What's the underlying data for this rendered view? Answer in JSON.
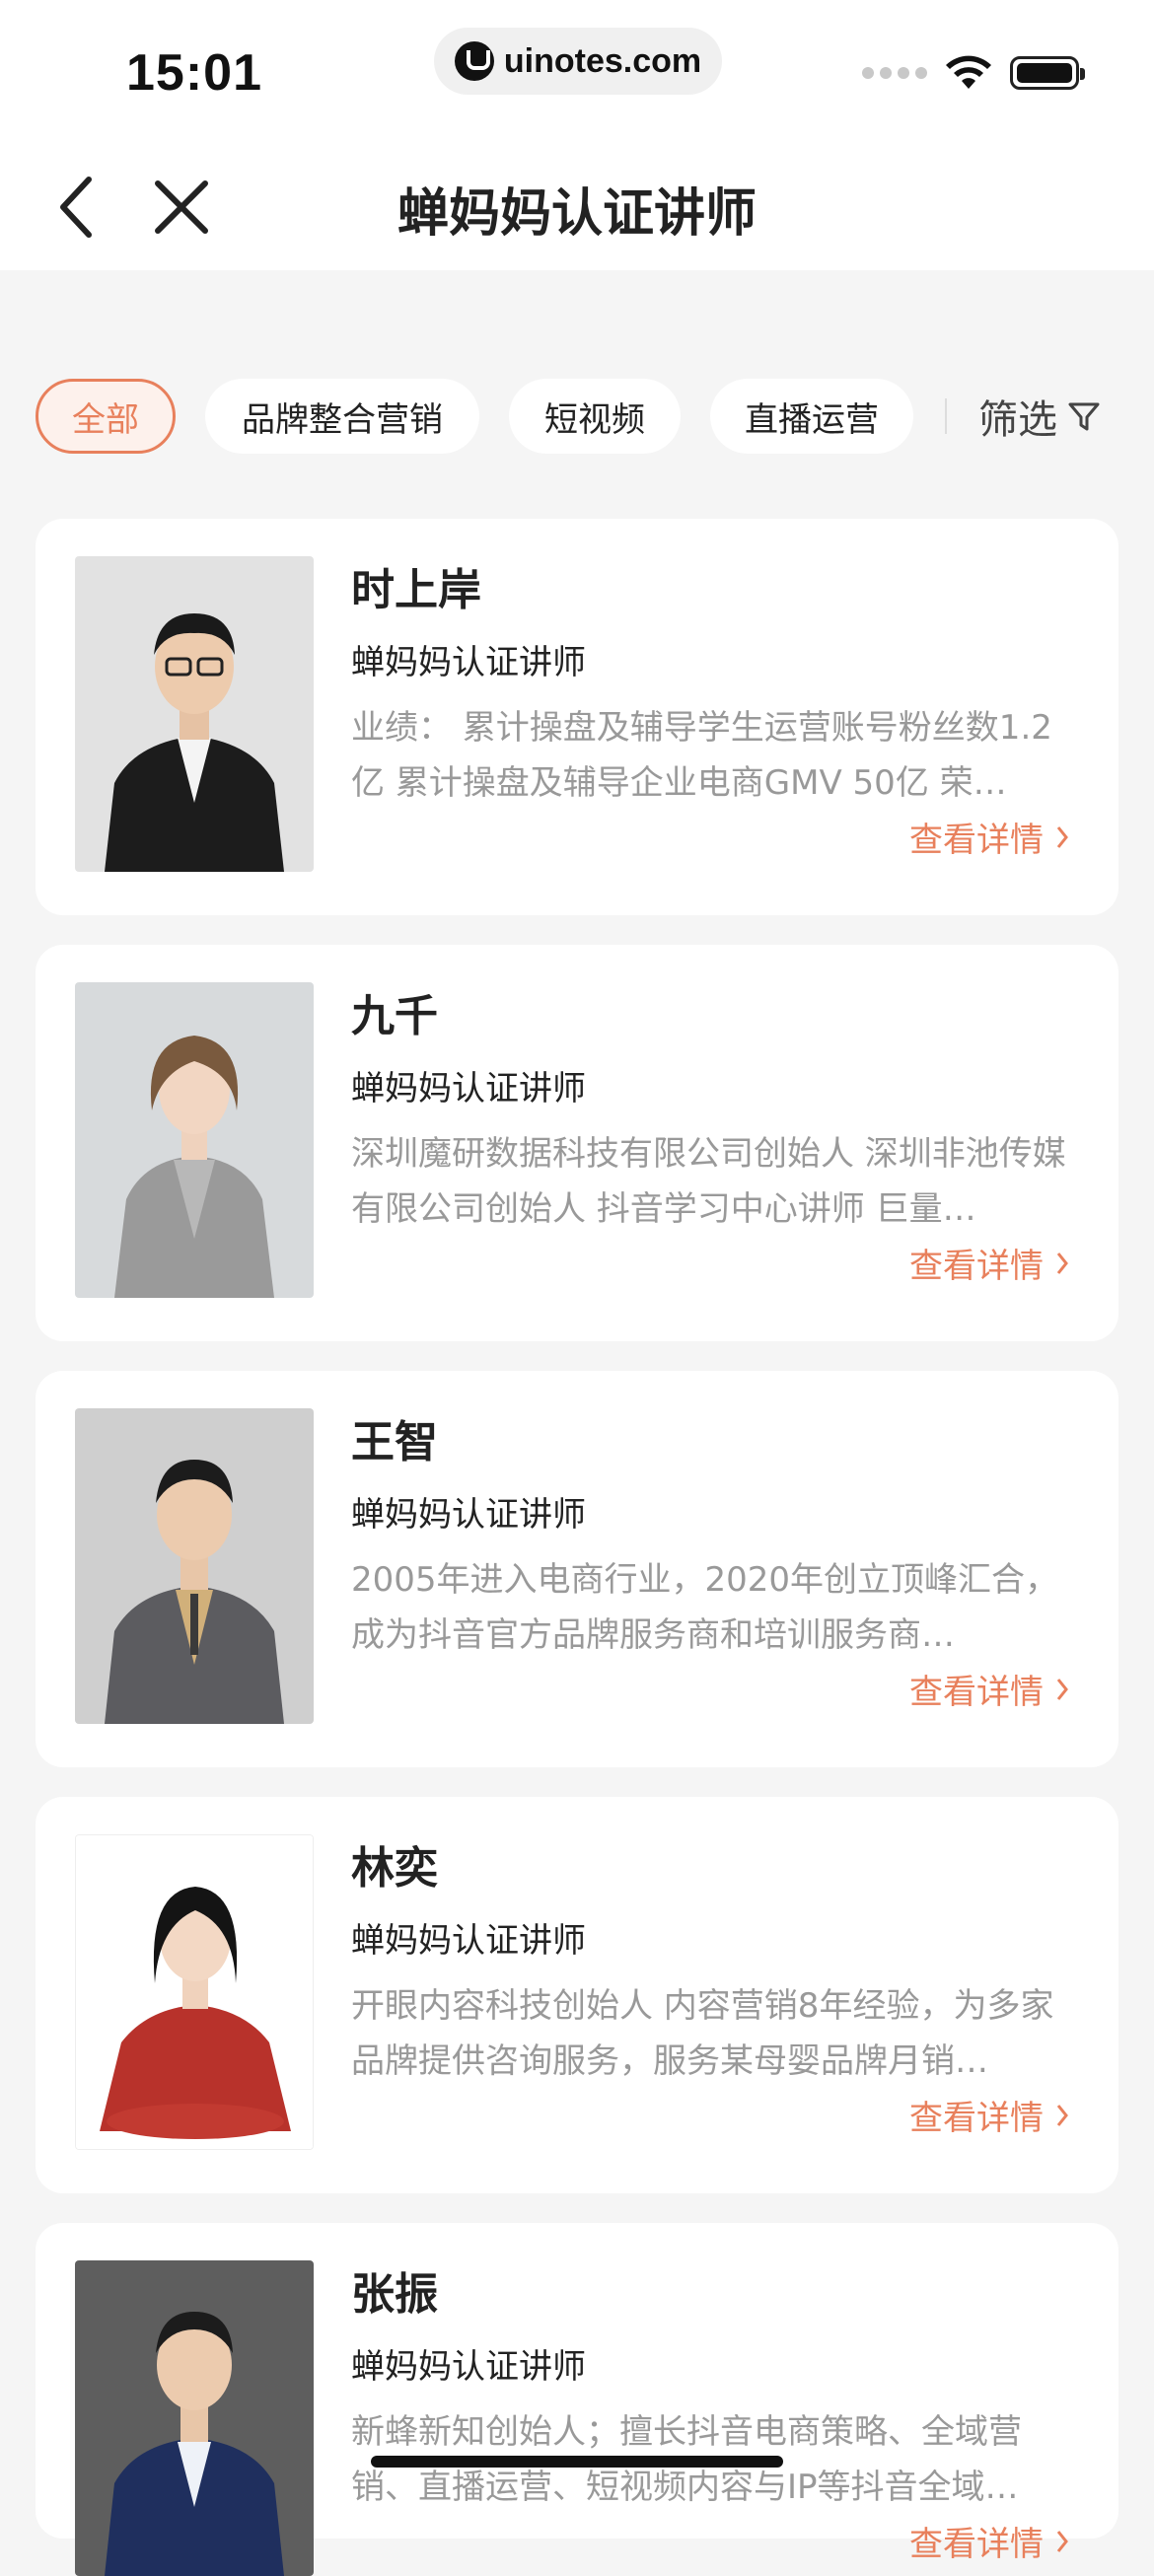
{
  "status_bar": {
    "time": "15:01",
    "url": "uinotes.com"
  },
  "nav": {
    "title": "蝉妈妈认证讲师"
  },
  "filters": {
    "chips": [
      "全部",
      "品牌整合营销",
      "短视频",
      "直播运营"
    ],
    "active_index": 0,
    "filter_label": "筛选"
  },
  "colors": {
    "accent": "#e8805c",
    "background": "#f5f5f5",
    "card": "#ffffff"
  },
  "lecturers": [
    {
      "name": "时上岸",
      "title": "蝉妈妈认证讲师",
      "desc": "业绩： 累计操盘及辅导学生运营账号粉丝数1.2亿 累计操盘及辅导企业电商GMV 50亿 荣…",
      "link": "查看详情"
    },
    {
      "name": "九千",
      "title": "蝉妈妈认证讲师",
      "desc": "深圳魔研数据科技有限公司创始人 深圳非池传媒有限公司创始人 抖音学习中心讲师 巨量…",
      "link": "查看详情"
    },
    {
      "name": "王智",
      "title": "蝉妈妈认证讲师",
      "desc": "2005年进入电商行业，2020年创立顶峰汇合，成为抖音官方品牌服务商和培训服务商…",
      "link": "查看详情"
    },
    {
      "name": "林奕",
      "title": "蝉妈妈认证讲师",
      "desc": "开眼内容科技创始人 内容营销8年经验，为多家品牌提供咨询服务，服务某母婴品牌月销…",
      "link": "查看详情"
    },
    {
      "name": "张振",
      "title": "蝉妈妈认证讲师",
      "desc": "新蜂新知创始人；擅长抖音电商策略、全域营销、直播运营、短视频内容与IP等抖音全域…",
      "link": "查看详情"
    }
  ]
}
